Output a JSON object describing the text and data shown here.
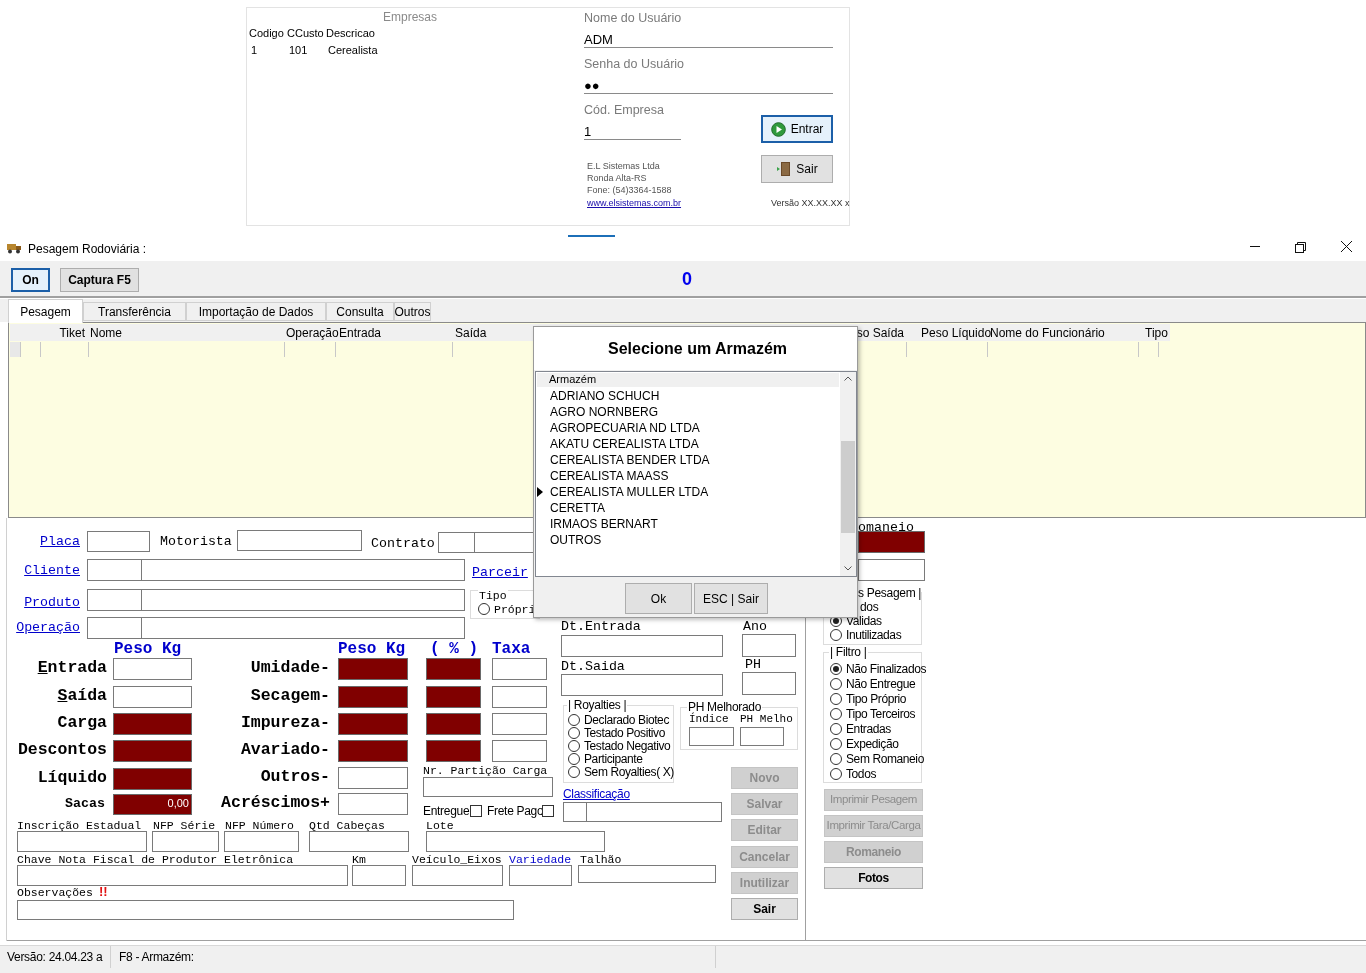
{
  "login": {
    "companies": {
      "title": "Empresas",
      "columns": [
        "Codigo",
        "CCusto",
        "Descricao"
      ],
      "rows": [
        [
          "1",
          "101",
          "Cerealista"
        ]
      ]
    },
    "fields": [
      {
        "label": "Nome do Usuário",
        "value": "ADM"
      },
      {
        "label": "Senha do Usuário",
        "value": "●●"
      },
      {
        "label": "Cód. Empresa",
        "value": "1"
      }
    ],
    "buttons": [
      {
        "label": "Entrar",
        "kind": "enter",
        "focused": true
      },
      {
        "label": "Sair",
        "kind": "exit",
        "focused": false
      }
    ],
    "company_info": [
      "E.L Sistemas Ltda",
      "Ronda Alta-RS",
      "Fone: (54)3364-1588"
    ],
    "website": "www.elsistemas.com.br",
    "version": "Versão XX.XX.XX x"
  },
  "window": {
    "title": "Pesagem Rodoviária :"
  },
  "toolbar": {
    "buttons": [
      {
        "label": "On",
        "focused": true
      },
      {
        "label": "Captura F5",
        "focused": false
      }
    ],
    "counter": "0"
  },
  "tabs": [
    {
      "label": "Pesagem",
      "selected": true
    },
    {
      "label": "Transferência",
      "selected": false
    },
    {
      "label": "Importação de Dados",
      "selected": false
    },
    {
      "label": "Consulta",
      "selected": false
    },
    {
      "label": "Outros",
      "selected": false
    }
  ],
  "grid": {
    "columns": [
      "Tiket",
      "Nome",
      "Operação",
      "Entrada",
      "Saída",
      "so Saída",
      "Peso Líquido",
      "Nome do Funcionário",
      "Tipo"
    ]
  },
  "form": {
    "links": {
      "placa": "Placa",
      "cliente": "Cliente",
      "produto": "Produto",
      "operacao": "Operação",
      "parceiro": "Parceir",
      "classificacao": "Classificação"
    },
    "labels": {
      "motorista": "Motorista",
      "contrato": "Contrato",
      "tipo": "Tipo"
    },
    "tipo_options": [
      {
        "label": "Própri",
        "checked": false
      }
    ],
    "weights": {
      "header": "Peso Kg",
      "rows": [
        {
          "label": "Entrada",
          "mnemonic": true,
          "highlighted": false
        },
        {
          "label": "Saída",
          "mnemonic": true,
          "highlighted": false
        },
        {
          "label": "Carga",
          "mnemonic": false,
          "highlighted": true
        },
        {
          "label": "Descontos",
          "mnemonic": false,
          "highlighted": true
        },
        {
          "label": "Líquido",
          "mnemonic": false,
          "highlighted": true
        }
      ],
      "sacas": {
        "label": "Sacas",
        "value": "0,00",
        "highlighted": true
      }
    },
    "discounts": {
      "headers": [
        "Peso Kg",
        "( % )",
        "Taxa"
      ],
      "rows": [
        {
          "label": "Umidade-",
          "kind": "percent",
          "highlighted": true
        },
        {
          "label": "Secagem-",
          "kind": "percent",
          "highlighted": true
        },
        {
          "label": "Impureza-",
          "kind": "percent",
          "highlighted": true
        },
        {
          "label": "Avariado-",
          "kind": "percent",
          "highlighted": true
        },
        {
          "label": "Outros-",
          "kind": "plain",
          "highlighted": false
        },
        {
          "label": "Acréscimos+",
          "kind": "plain",
          "highlighted": false
        }
      ]
    },
    "particao": "Nr. Partição Carga",
    "checkboxes": [
      {
        "label": "Entregue",
        "checked": false
      },
      {
        "label": "Frete Pago",
        "checked": false
      }
    ],
    "dates": {
      "entrada": "Dt.Entrada",
      "ano": "Ano",
      "saida": "Dt.Saida",
      "ph": "PH"
    },
    "royalties": {
      "title": "| Royalties |",
      "options": [
        {
          "label": "Declarado Biotec",
          "checked": false
        },
        {
          "label": "Testado Positivo",
          "checked": false
        },
        {
          "label": "Testado Negativo",
          "checked": false
        },
        {
          "label": "Participante",
          "checked": false
        },
        {
          "label": "Sem Royalties( X)",
          "checked": false
        }
      ]
    },
    "ph_melhorado": {
      "title": "PH Melhorado",
      "columns": [
        "Índice",
        "PH Melho"
      ]
    },
    "bottom_fields": [
      {
        "label": "Inscrição Estadual",
        "kind": "plain"
      },
      {
        "label": "NFP Série",
        "kind": "plain"
      },
      {
        "label": "NFP Número",
        "kind": "plain"
      },
      {
        "label": "Qtd Cabeças",
        "kind": "plain"
      },
      {
        "label": "Lote",
        "kind": "plain"
      },
      {
        "label": "Chave Nota Fiscal de Produtor Eletrônica",
        "kind": "plain"
      },
      {
        "label": "Km",
        "kind": "plain"
      },
      {
        "label": "Veículo_Eixos",
        "kind": "plain"
      },
      {
        "label": "Variedade",
        "kind": "link"
      },
      {
        "label": "Talhão",
        "kind": "plain"
      }
    ],
    "observacoes": {
      "label": "Observações",
      "warning": "!!"
    },
    "actions": [
      {
        "label": "Novo",
        "disabled": true
      },
      {
        "label": "Salvar",
        "disabled": true
      },
      {
        "label": "Editar",
        "disabled": true
      },
      {
        "label": "Cancelar",
        "disabled": true
      },
      {
        "label": "Inutilizar",
        "disabled": true
      },
      {
        "label": "Sair",
        "disabled": false
      }
    ]
  },
  "side": {
    "romaneio": "omaneio",
    "status": {
      "title": "s Pesagem |",
      "partial_option": "dos",
      "options": [
        {
          "label": "Validas",
          "checked": true
        },
        {
          "label": "Inutilizadas",
          "checked": false
        }
      ]
    },
    "filter": {
      "title": "| Filtro |",
      "options": [
        {
          "label": "Não Finalizados",
          "checked": true
        },
        {
          "label": "Não Entregue",
          "checked": false
        },
        {
          "label": "Tipo Próprio",
          "checked": false
        },
        {
          "label": "Tipo Terceiros",
          "checked": false
        },
        {
          "label": "Entradas",
          "checked": false
        },
        {
          "label": "Expedição",
          "checked": false
        },
        {
          "label": "Sem Romaneio",
          "checked": false
        },
        {
          "label": "Todos",
          "checked": false
        }
      ]
    },
    "buttons": [
      {
        "label": "Imprimir Pesagem",
        "disabled": true
      },
      {
        "label": "Imprimir Tara/Carga",
        "disabled": true
      },
      {
        "label": "Romaneio",
        "disabled": true
      },
      {
        "label": "Fotos",
        "disabled": false
      }
    ]
  },
  "status_bar": [
    "Versão: 24.04.23 a",
    "F8 - Armazém:"
  ],
  "dialog": {
    "title": "Selecione um Armazém",
    "column": "Armazém",
    "items": [
      {
        "name": "ADRIANO SCHUCH",
        "selected": false
      },
      {
        "name": "AGRO NORNBERG",
        "selected": false
      },
      {
        "name": "AGROPECUARIA ND LTDA",
        "selected": false
      },
      {
        "name": "AKATU CEREALISTA LTDA",
        "selected": false
      },
      {
        "name": "CEREALISTA BENDER LTDA",
        "selected": false
      },
      {
        "name": "CEREALISTA MAASS",
        "selected": false
      },
      {
        "name": "CEREALISTA MULLER LTDA",
        "selected": true
      },
      {
        "name": "CERETTA",
        "selected": false
      },
      {
        "name": "IRMAOS BERNART",
        "selected": false
      },
      {
        "name": "OUTROS",
        "selected": false
      }
    ],
    "buttons": [
      "Ok",
      "ESC | Sair"
    ]
  }
}
